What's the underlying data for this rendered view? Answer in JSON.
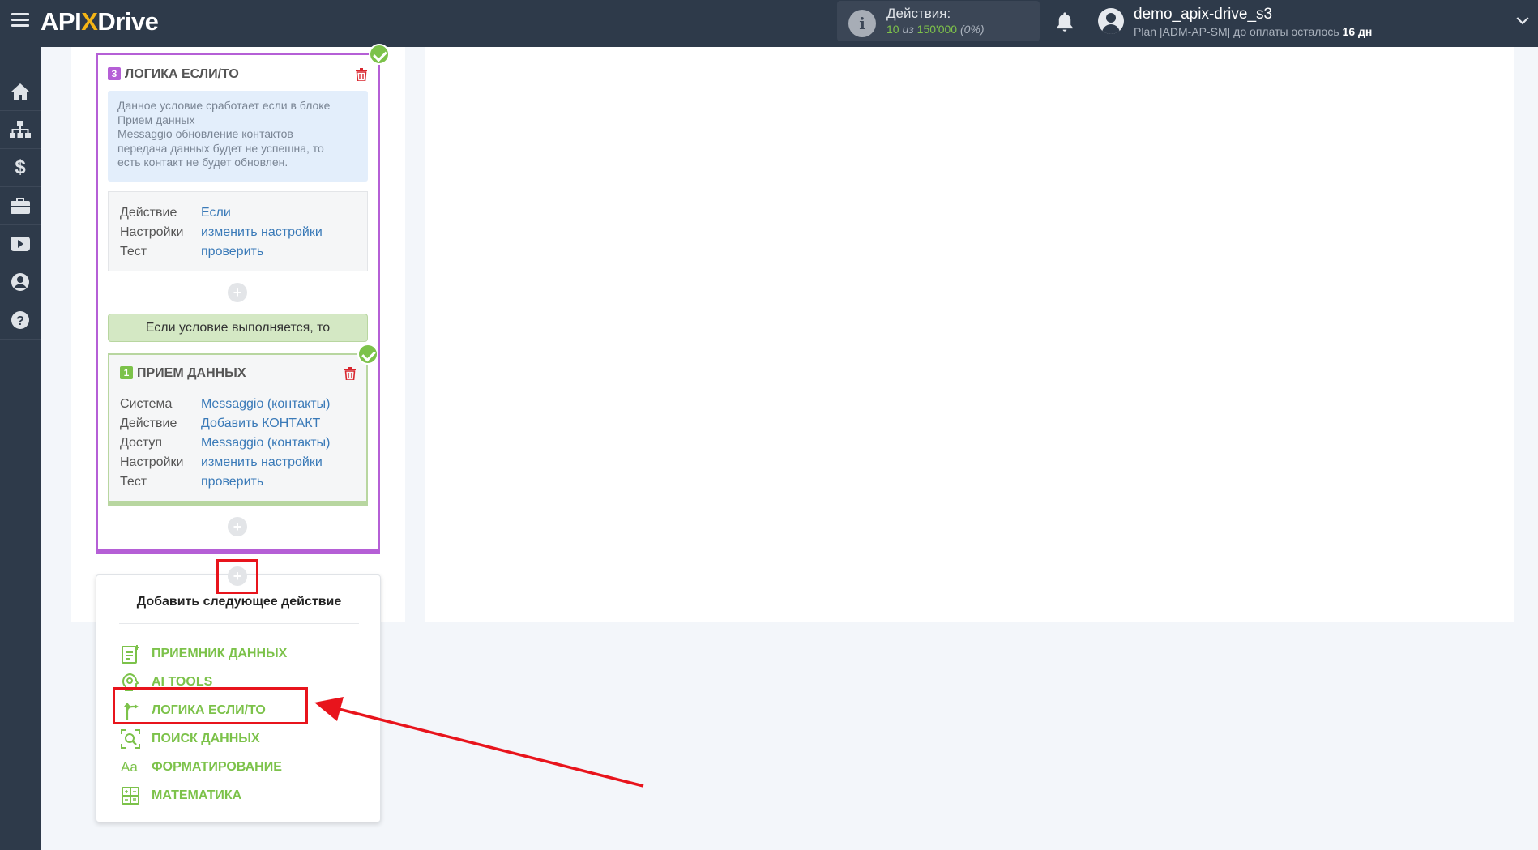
{
  "header": {
    "logo_api": "API",
    "logo_x": "X",
    "logo_drive": "Drive",
    "actions_label": "Действия:",
    "actions_used": "10",
    "actions_sep": " из ",
    "actions_total": "150'000",
    "actions_percent": "(0%)",
    "user_name": "demo_apix-drive_s3",
    "plan_text": "Plan |ADM-AP-SM| до оплаты осталось ",
    "plan_days": "16 дн"
  },
  "sidebar": {
    "items": [
      "home-icon",
      "sitemap-icon",
      "dollar-icon",
      "briefcase-icon",
      "youtube-icon",
      "user-circle-icon",
      "question-icon"
    ]
  },
  "logic_block": {
    "number": "3",
    "title": "ЛОГИКА ЕСЛИ/ТО",
    "note_lines": [
      "Данное условие сработает если в блоке",
      "Прием данных",
      "Messaggio обновление контактов",
      "передача данных будет не успешна, то",
      "есть контакт не будет обновлен."
    ],
    "props": [
      {
        "key": "Действие",
        "value": "Если"
      },
      {
        "key": "Настройки",
        "value": "изменить настройки"
      },
      {
        "key": "Тест",
        "value": "проверить"
      }
    ],
    "plus_symbol": "+",
    "condition_label": "Если условие выполняется, то"
  },
  "receive_block": {
    "number": "1",
    "title": "ПРИЕМ ДАННЫХ",
    "props": [
      {
        "key": "Система",
        "value": "Messaggio (контакты)"
      },
      {
        "key": "Действие",
        "value": "Добавить КОНТАКТ"
      },
      {
        "key": "Доступ",
        "value": "Messaggio (контакты)"
      },
      {
        "key": "Настройки",
        "value": "изменить настройки"
      },
      {
        "key": "Тест",
        "value": "проверить"
      }
    ]
  },
  "add_menu": {
    "title": "Добавить следующее действие",
    "items": [
      {
        "label": "ПРИЕМНИК ДАННЫХ",
        "icon": "document-plus-icon"
      },
      {
        "label": "AI TOOLS",
        "icon": "ai-head-icon"
      },
      {
        "label": "ЛОГИКА ЕСЛИ/ТО",
        "icon": "branch-icon"
      },
      {
        "label": "ПОИСК ДАННЫХ",
        "icon": "search-data-icon"
      },
      {
        "label": "ФОРМАТИРОВАНИЕ",
        "icon": "text-format-icon"
      },
      {
        "label": "МАТЕМАТИКА",
        "icon": "calculator-icon"
      }
    ],
    "format_icon_text": "Aa"
  },
  "colors": {
    "header_bg": "#2e3a4a",
    "logic_accent": "#b55fd6",
    "green_accent": "#7cc24a",
    "link_blue": "#3a7ab8",
    "highlight_red": "#e8141c"
  }
}
